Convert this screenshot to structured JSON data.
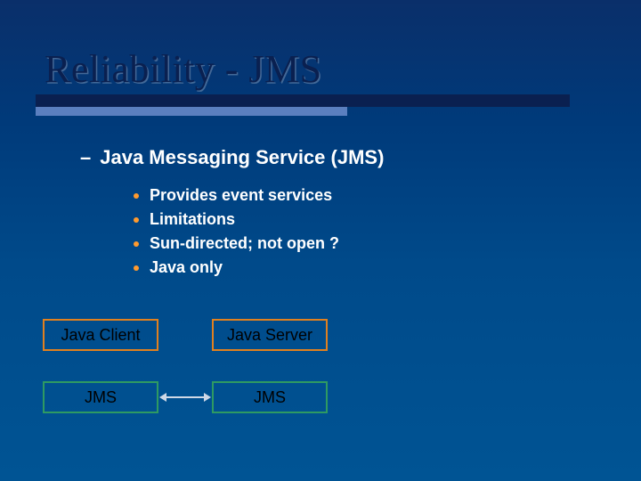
{
  "title": "Reliability - JMS",
  "subheading": {
    "dash": "–",
    "text": "Java Messaging Service (JMS)"
  },
  "bullets": [
    "Provides event services",
    "Limitations",
    "Sun-directed;  not open ?",
    "Java only"
  ],
  "diagram": {
    "client": "Java Client",
    "server": "Java Server",
    "jms_left": "JMS",
    "jms_right": "JMS"
  },
  "colors": {
    "accent_bullet": "#ff9a2e",
    "box_orange": "#e0801f",
    "box_green": "#2e9a62",
    "title_dark": "#0a2050"
  }
}
